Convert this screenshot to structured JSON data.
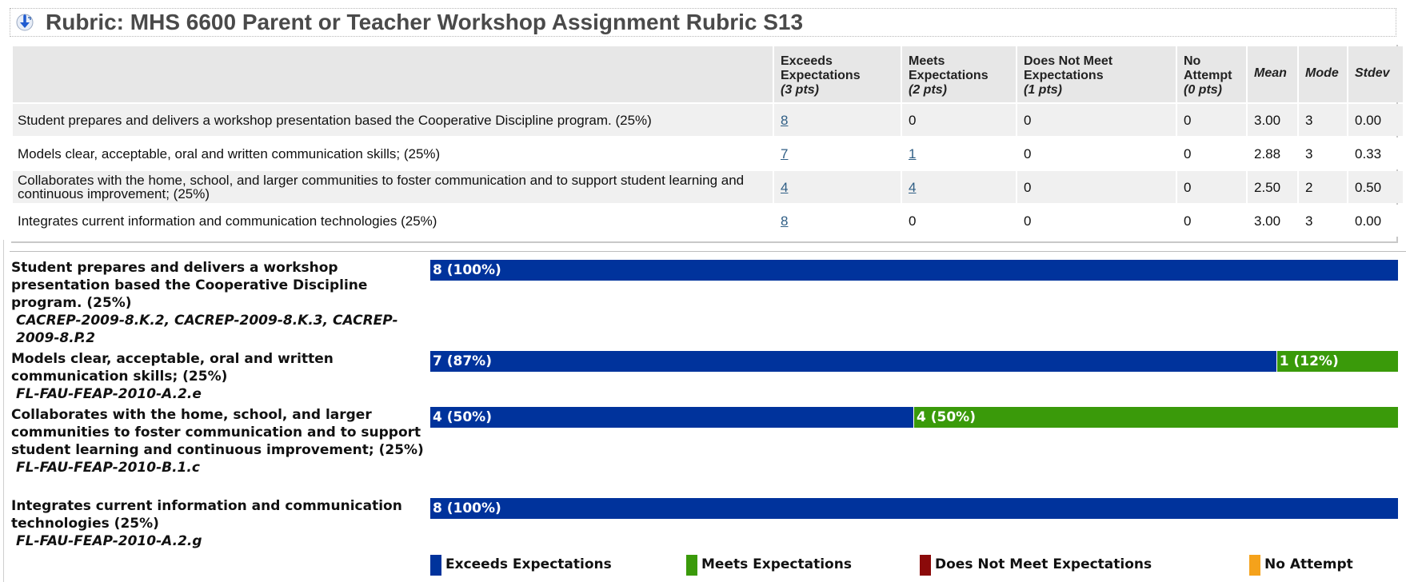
{
  "header": {
    "title": "Rubric: MHS 6600 Parent or Teacher Workshop Assignment Rubric S13",
    "icon": "download-arrow-icon"
  },
  "table": {
    "columns": [
      {
        "name": "Exceeds Expectations",
        "pts": "(3 pts)"
      },
      {
        "name": "Meets Expectations",
        "pts": "(2 pts)"
      },
      {
        "name": "Does Not Meet Expectations",
        "pts": "(1 pts)"
      },
      {
        "name": "No Attempt",
        "pts": "(0 pts)"
      }
    ],
    "stat_headers": {
      "mean": "Mean",
      "mode": "Mode",
      "stdev": "Stdev"
    },
    "rows": [
      {
        "criterion": "Student prepares and delivers a workshop presentation based the Cooperative Discipline program. (25%)",
        "exceeds": "8",
        "meets": "0",
        "not_meet": "0",
        "no_attempt": "0",
        "mean": "3.00",
        "mode": "3",
        "stdev": "0.00"
      },
      {
        "criterion": "Models clear, acceptable, oral and written communication skills; (25%)",
        "exceeds": "7",
        "meets": "1",
        "not_meet": "0",
        "no_attempt": "0",
        "mean": "2.88",
        "mode": "3",
        "stdev": "0.33"
      },
      {
        "criterion": "Collaborates with the home, school, and larger communities to foster communication and to support student learning and continuous improvement; (25%)",
        "exceeds": "4",
        "meets": "4",
        "not_meet": "0",
        "no_attempt": "0",
        "mean": "2.50",
        "mode": "2",
        "stdev": "0.50"
      },
      {
        "criterion": "Integrates current information and communication technologies (25%)",
        "exceeds": "8",
        "meets": "0",
        "not_meet": "0",
        "no_attempt": "0",
        "mean": "3.00",
        "mode": "3",
        "stdev": "0.00"
      }
    ]
  },
  "chart": {
    "criteria": [
      {
        "label": "Student prepares and delivers a workshop presentation based the Cooperative Discipline program. (25%)",
        "standards": "CACREP-2009-8.K.2, CACREP-2009-8.K.3, CACREP-2009-8.P.2"
      },
      {
        "label": "Models clear, acceptable, oral and written communication skills; (25%)",
        "standards": "FL-FAU-FEAP-2010-A.2.e"
      },
      {
        "label": "Collaborates with the home, school, and larger communities to foster communication and to support student learning and continuous improvement; (25%)",
        "standards": "FL-FAU-FEAP-2010-B.1.c"
      },
      {
        "label": "Integrates current information and communication technologies (25%)",
        "standards": "FL-FAU-FEAP-2010-A.2.g"
      }
    ],
    "legend": [
      {
        "label": "Exceeds Expectations",
        "color": "#00339c"
      },
      {
        "label": "Meets Expectations",
        "color": "#3a9a0a"
      },
      {
        "label": "Does Not Meet Expectations",
        "color": "#8b0a0a"
      },
      {
        "label": "No Attempt",
        "color": "#f5a21b"
      }
    ]
  },
  "chart_data": {
    "type": "bar",
    "orientation": "horizontal-stacked",
    "categories": [
      "Student prepares and delivers a workshop presentation based the Cooperative Discipline program. (25%)",
      "Models clear, acceptable, oral and written communication skills; (25%)",
      "Collaborates with the home, school, and larger communities to foster communication and to support student learning and continuous improvement; (25%)",
      "Integrates current information and communication technologies (25%)"
    ],
    "series": [
      {
        "name": "Exceeds Expectations",
        "values": [
          8,
          7,
          4,
          8
        ],
        "labels": [
          "8 (100%)",
          "7 (87%)",
          "4 (50%)",
          "8 (100%)"
        ],
        "fractions": [
          1.0,
          0.875,
          0.5,
          1.0
        ]
      },
      {
        "name": "Meets Expectations",
        "values": [
          0,
          1,
          4,
          0
        ],
        "labels": [
          "",
          "1 (12%)",
          "4 (50%)",
          ""
        ],
        "fractions": [
          0,
          0.125,
          0.5,
          0
        ]
      },
      {
        "name": "Does Not Meet Expectations",
        "values": [
          0,
          0,
          0,
          0
        ],
        "labels": [
          "",
          "",
          "",
          ""
        ],
        "fractions": [
          0,
          0,
          0,
          0
        ]
      },
      {
        "name": "No Attempt",
        "values": [
          0,
          0,
          0,
          0
        ],
        "labels": [
          "",
          "",
          "",
          ""
        ],
        "fractions": [
          0,
          0,
          0,
          0
        ]
      }
    ],
    "legend_position": "bottom"
  }
}
